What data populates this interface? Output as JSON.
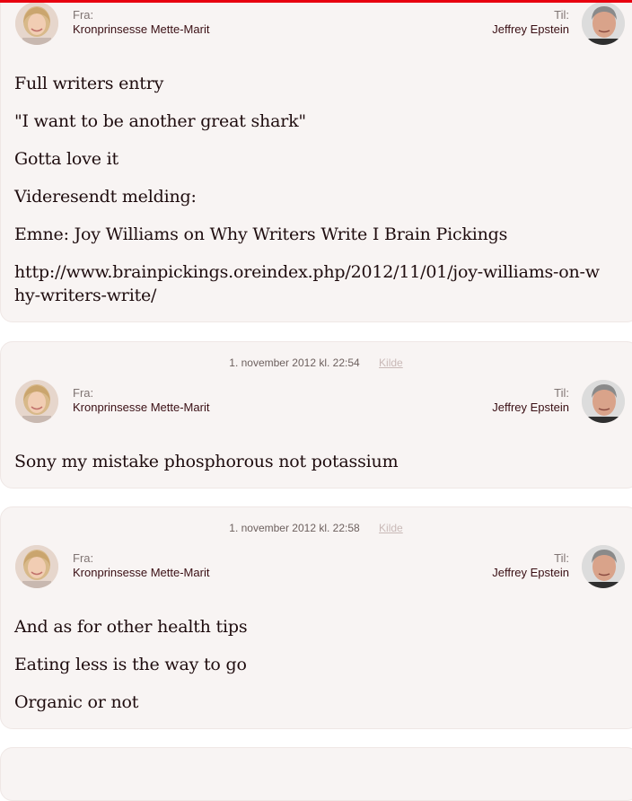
{
  "messages": [
    {
      "date": "",
      "source_label": "",
      "from_label": "Fra:",
      "from_name": "Kronprinsesse Mette-Marit",
      "to_label": "Til:",
      "to_name": "Jeffrey Epstein",
      "lines": [
        "Full writers entry",
        "\"I want to be another great shark\"",
        "Gotta love it",
        "Videresendt melding:",
        "Emne: Joy Williams on Why Writers Write I Brain Pickings",
        "http://www.brainpickings.oreindex.php/2012/11/01/joy-williams-on-why-writers-write/"
      ]
    },
    {
      "date": "1. november 2012 kl. 22:54",
      "source_label": "Kilde",
      "from_label": "Fra:",
      "from_name": "Kronprinsesse Mette-Marit",
      "to_label": "Til:",
      "to_name": "Jeffrey Epstein",
      "lines": [
        "Sony my mistake phosphorous not potassium"
      ]
    },
    {
      "date": "1. november 2012 kl. 22:58",
      "source_label": "Kilde",
      "from_label": "Fra:",
      "from_name": "Kronprinsesse Mette-Marit",
      "to_label": "Til:",
      "to_name": "Jeffrey Epstein",
      "lines": [
        "And as for other health tips",
        "Eating less is the way to go",
        "Organic or not"
      ]
    }
  ],
  "colors": {
    "accent_bar": "#e8000f",
    "card_background": "#f8f4f3",
    "name_text": "#3a0f14",
    "source_link": "#c9b9b7"
  },
  "icons": {
    "sender_avatar": "woman-portrait-avatar",
    "recipient_avatar": "man-portrait-avatar"
  }
}
